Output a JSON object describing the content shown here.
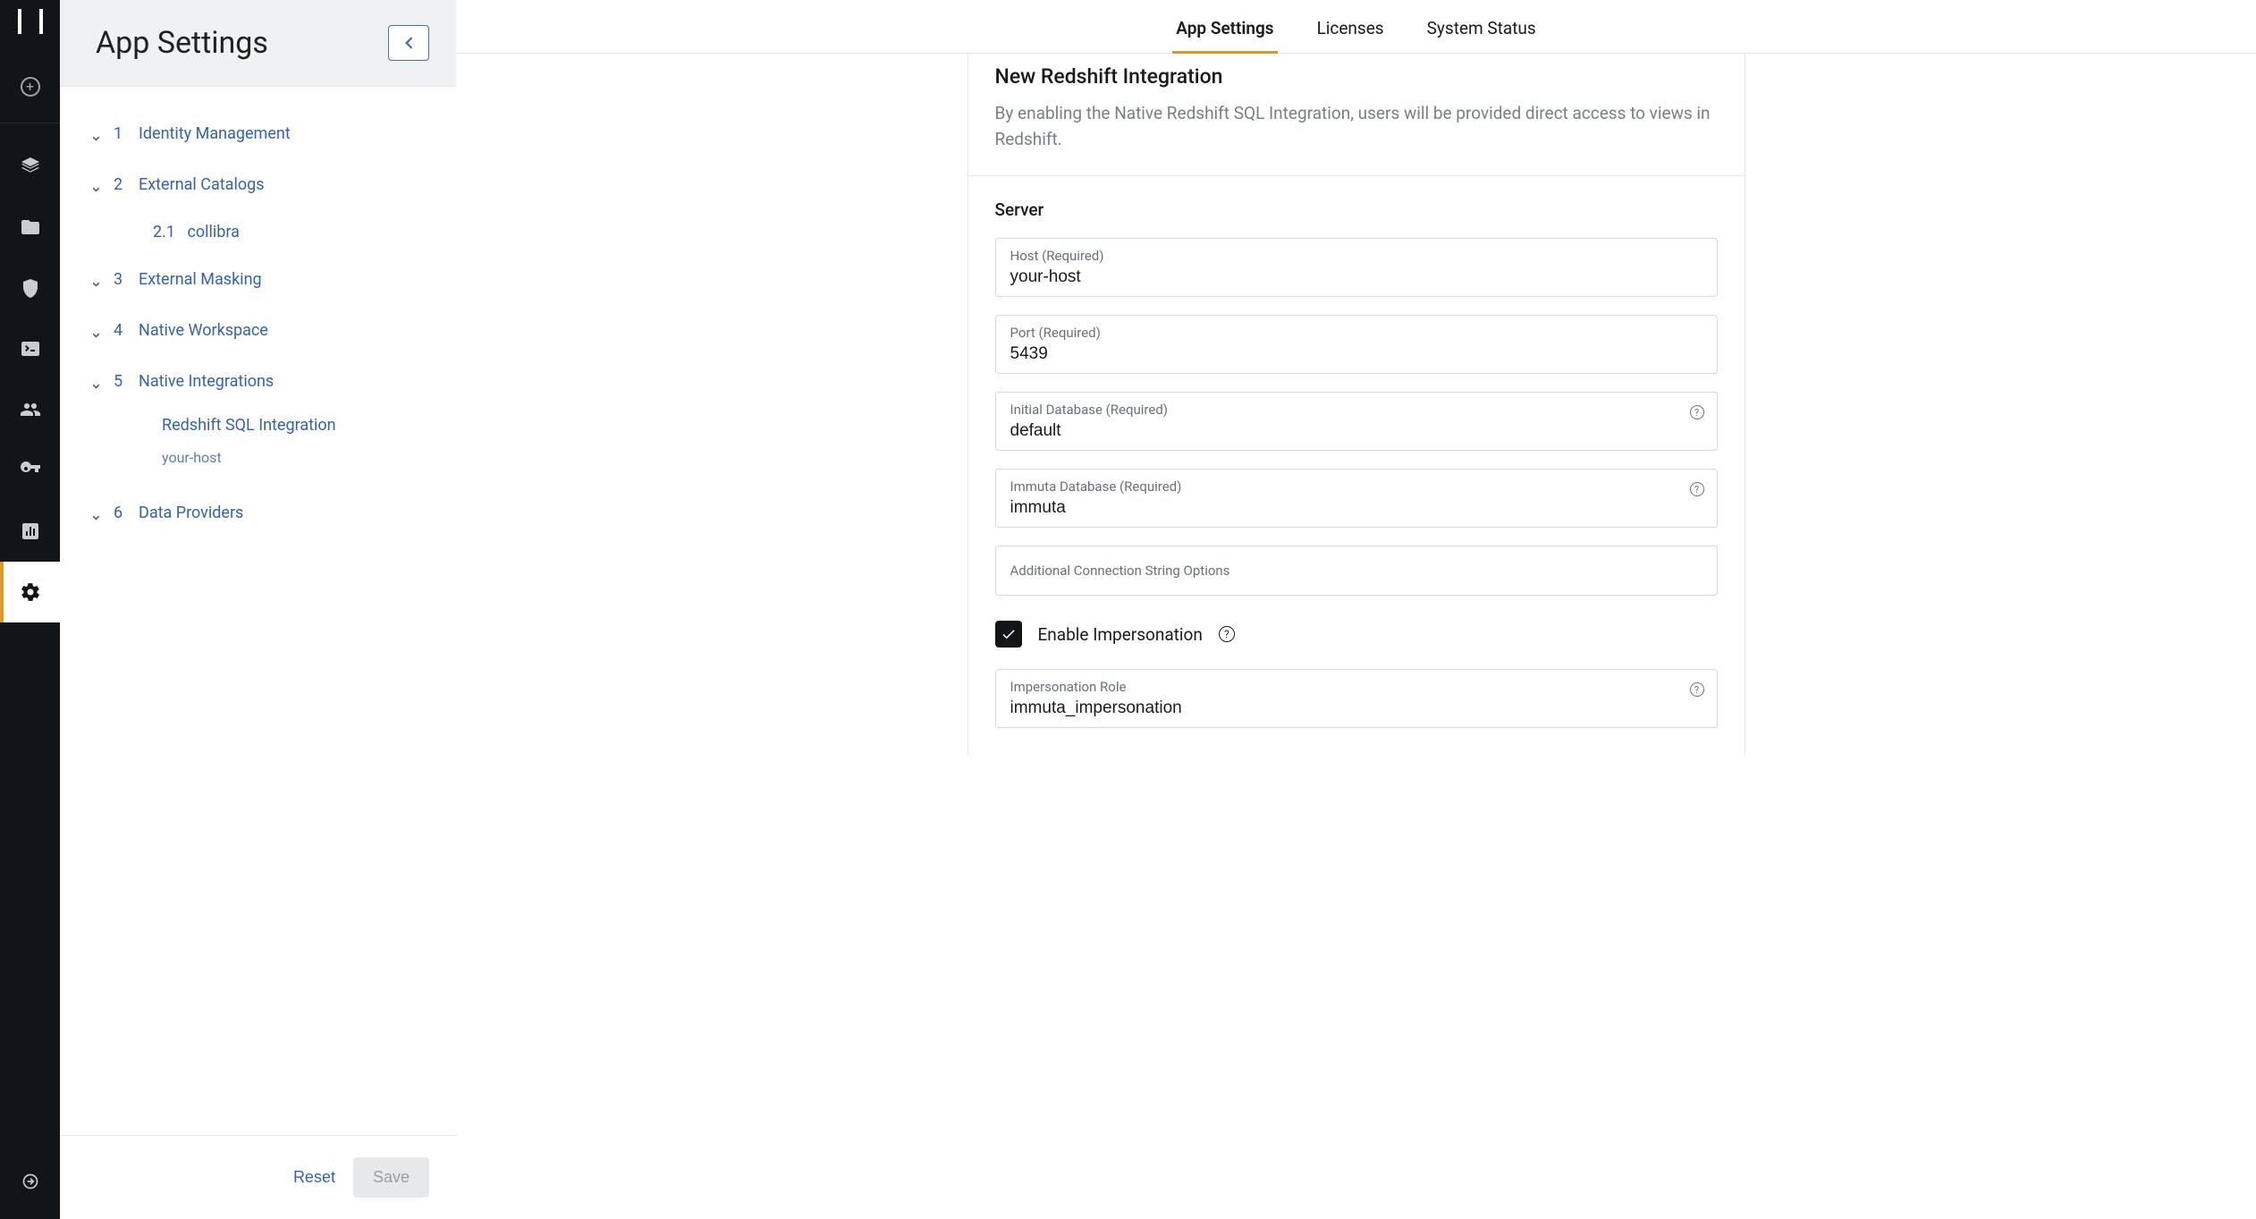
{
  "sidebar_title": "App Settings",
  "tabs": {
    "app_settings": "App Settings",
    "licenses": "Licenses",
    "system_status": "System Status"
  },
  "nav": {
    "identity": {
      "num": "1",
      "label": "Identity Management"
    },
    "external_catalogs": {
      "num": "2",
      "label": "External Catalogs"
    },
    "collibra": {
      "num": "2.1",
      "label": "collibra"
    },
    "external_masking": {
      "num": "3",
      "label": "External Masking"
    },
    "native_workspace": {
      "num": "4",
      "label": "Native Workspace"
    },
    "native_integrations": {
      "num": "5",
      "label": "Native Integrations"
    },
    "redshift": "Redshift SQL Integration",
    "redshift_host": "your-host",
    "data_providers": {
      "num": "6",
      "label": "Data Providers"
    }
  },
  "footer": {
    "reset": "Reset",
    "save": "Save"
  },
  "panel": {
    "title": "New Redshift Integration",
    "desc": "By enabling the Native Redshift SQL Integration, users will be provided direct access to views in Redshift.",
    "server_heading": "Server",
    "host_label": "Host (Required)",
    "host_value": "your-host",
    "port_label": "Port (Required)",
    "port_value": "5439",
    "initdb_label": "Initial Database (Required)",
    "initdb_value": "default",
    "immutadb_label": "Immuta Database (Required)",
    "immutadb_value": "immuta",
    "addl_label": "Additional Connection String Options",
    "impersonation_label": "Enable Impersonation",
    "improle_label": "Impersonation Role",
    "improle_value": "immuta_impersonation"
  }
}
